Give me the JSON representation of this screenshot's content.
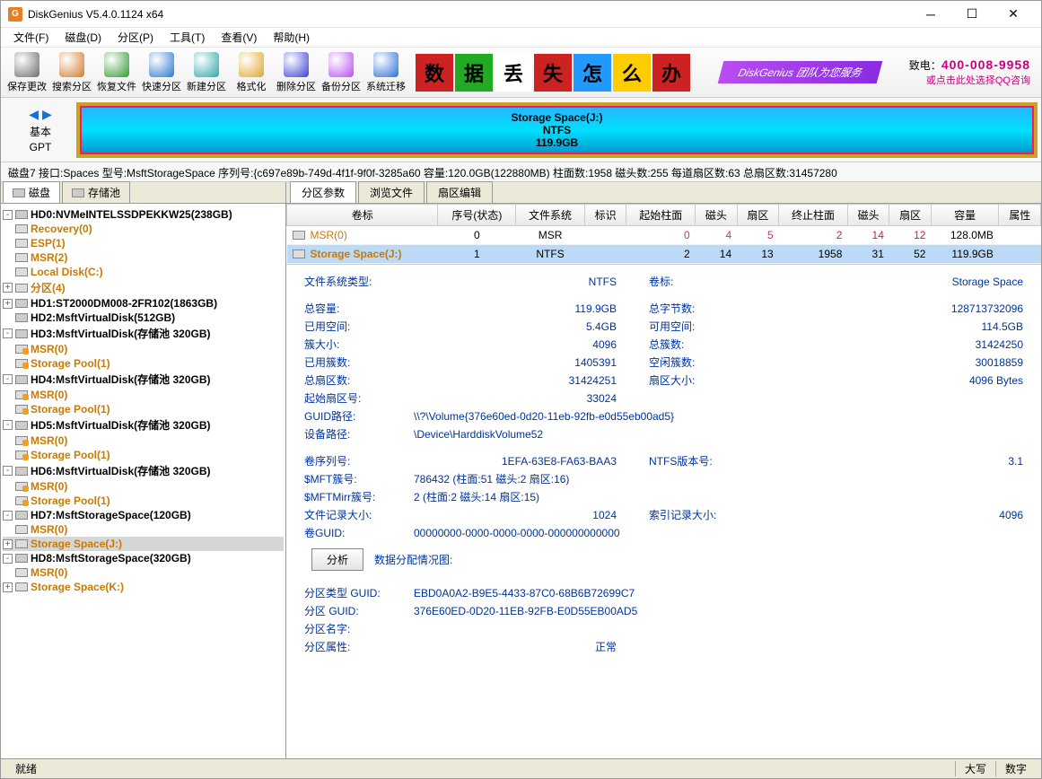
{
  "window": {
    "title": "DiskGenius V5.4.0.1124 x64",
    "icon_letter": "G"
  },
  "menu": [
    "文件(F)",
    "磁盘(D)",
    "分区(P)",
    "工具(T)",
    "查看(V)",
    "帮助(H)"
  ],
  "toolbar": [
    {
      "label": "保存更改",
      "color": "#6b6b6b"
    },
    {
      "label": "搜索分区",
      "color": "#d37a2a"
    },
    {
      "label": "恢复文件",
      "color": "#2e9a2e"
    },
    {
      "label": "快速分区",
      "color": "#2a77d3"
    },
    {
      "label": "新建分区",
      "color": "#2aa7a7"
    },
    {
      "label": "格式化",
      "color": "#e0a62a"
    },
    {
      "label": "删除分区",
      "color": "#3a3fd6"
    },
    {
      "label": "备份分区",
      "color": "#b84df0"
    },
    {
      "label": "系统迁移",
      "color": "#2a6fd6"
    }
  ],
  "promo": {
    "chars": [
      [
        "数",
        "#c22"
      ],
      [
        "据",
        "#2a2"
      ],
      [
        "丢",
        "#fff"
      ],
      [
        "失",
        "#c22"
      ],
      [
        "怎",
        "#29f"
      ],
      [
        "么",
        "#fc0"
      ],
      [
        "办",
        "#c22"
      ]
    ],
    "bubble": "DiskGenius 团队为您服务",
    "line1_pre": "致电：",
    "phone": "400-008-9958",
    "line2": "或点击此处选择QQ咨询"
  },
  "diskbar": {
    "left_l1": "基本",
    "left_l2": "GPT",
    "strip_l1": "Storage Space(J:)",
    "strip_l2": "NTFS",
    "strip_l3": "119.9GB"
  },
  "infoline": "磁盘7 接口:Spaces  型号:MsftStorageSpace  序列号:{c697e89b-749d-4f1f-9f0f-3285a60  容量:120.0GB(122880MB)  柱面数:1958  磁头数:255  每道扇区数:63  总扇区数:31457280",
  "lefttabs": {
    "t1": " 磁盘",
    "t2": " 存储池"
  },
  "tree": [
    {
      "d": 0,
      "exp": "-",
      "ico": "disk",
      "lbl": "HD0:NVMeINTELSSDPEKKW25(238GB)",
      "bold": true
    },
    {
      "d": 1,
      "exp": "",
      "ico": "vol",
      "lbl": "Recovery(0)",
      "cls": "orange"
    },
    {
      "d": 1,
      "exp": "",
      "ico": "vol",
      "lbl": "ESP(1)",
      "cls": "orange"
    },
    {
      "d": 1,
      "exp": "",
      "ico": "vol",
      "lbl": "MSR(2)",
      "cls": "orange"
    },
    {
      "d": 1,
      "exp": "",
      "ico": "vol",
      "lbl": "Local Disk(C:)",
      "cls": "orange"
    },
    {
      "d": 1,
      "exp": "+",
      "ico": "vol",
      "lbl": "分区(4)",
      "cls": "orange"
    },
    {
      "d": 0,
      "exp": "+",
      "ico": "disk",
      "lbl": "HD1:ST2000DM008-2FR102(1863GB)",
      "bold": true
    },
    {
      "d": 0,
      "exp": "",
      "ico": "disk",
      "lbl": "HD2:MsftVirtualDisk(512GB)",
      "bold": true
    },
    {
      "d": 0,
      "exp": "-",
      "ico": "disk",
      "lbl": "HD3:MsftVirtualDisk(存储池 320GB)",
      "bold": true
    },
    {
      "d": 1,
      "exp": "",
      "ico": "vollock",
      "lbl": "MSR(0)",
      "cls": "orange"
    },
    {
      "d": 1,
      "exp": "",
      "ico": "vollock",
      "lbl": "Storage Pool(1)",
      "cls": "orange"
    },
    {
      "d": 0,
      "exp": "-",
      "ico": "disk",
      "lbl": "HD4:MsftVirtualDisk(存储池 320GB)",
      "bold": true
    },
    {
      "d": 1,
      "exp": "",
      "ico": "vollock",
      "lbl": "MSR(0)",
      "cls": "orange"
    },
    {
      "d": 1,
      "exp": "",
      "ico": "vollock",
      "lbl": "Storage Pool(1)",
      "cls": "orange"
    },
    {
      "d": 0,
      "exp": "-",
      "ico": "disk",
      "lbl": "HD5:MsftVirtualDisk(存储池 320GB)",
      "bold": true
    },
    {
      "d": 1,
      "exp": "",
      "ico": "vollock",
      "lbl": "MSR(0)",
      "cls": "orange"
    },
    {
      "d": 1,
      "exp": "",
      "ico": "vollock",
      "lbl": "Storage Pool(1)",
      "cls": "orange"
    },
    {
      "d": 0,
      "exp": "-",
      "ico": "disk",
      "lbl": "HD6:MsftVirtualDisk(存储池 320GB)",
      "bold": true
    },
    {
      "d": 1,
      "exp": "",
      "ico": "vollock",
      "lbl": "MSR(0)",
      "cls": "orange"
    },
    {
      "d": 1,
      "exp": "",
      "ico": "vollock",
      "lbl": "Storage Pool(1)",
      "cls": "orange"
    },
    {
      "d": 0,
      "exp": "-",
      "ico": "disk",
      "lbl": "HD7:MsftStorageSpace(120GB)",
      "bold": true
    },
    {
      "d": 1,
      "exp": "",
      "ico": "vol",
      "lbl": "MSR(0)",
      "cls": "orange"
    },
    {
      "d": 1,
      "exp": "+",
      "ico": "vol",
      "lbl": "Storage Space(J:)",
      "cls": "orange",
      "hl": true
    },
    {
      "d": 0,
      "exp": "-",
      "ico": "disk",
      "lbl": "HD8:MsftStorageSpace(320GB)",
      "bold": true
    },
    {
      "d": 1,
      "exp": "",
      "ico": "vol",
      "lbl": "MSR(0)",
      "cls": "orange"
    },
    {
      "d": 1,
      "exp": "+",
      "ico": "vol",
      "lbl": "Storage Space(K:)",
      "cls": "orange"
    }
  ],
  "righttabs": [
    "分区参数",
    "浏览文件",
    "扇区编辑"
  ],
  "grid": {
    "cols": [
      "卷标",
      "序号(状态)",
      "文件系统",
      "标识",
      "起始柱面",
      "磁头",
      "扇区",
      "终止柱面",
      "磁头",
      "扇区",
      "容量",
      "属性"
    ],
    "rows": [
      {
        "name": "MSR(0)",
        "seq": "0",
        "fs": "MSR",
        "flag": "",
        "sc": "0",
        "sh": "4",
        "ss": "5",
        "ec": "2",
        "eh": "14",
        "es": "12",
        "cap": "128.0MB",
        "attr": "",
        "sel": false,
        "cls": "pink red"
      },
      {
        "name": "Storage Space(J:)",
        "seq": "1",
        "fs": "NTFS",
        "flag": "",
        "sc": "2",
        "sh": "14",
        "ss": "13",
        "ec": "1958",
        "eh": "31",
        "es": "52",
        "cap": "119.9GB",
        "attr": "",
        "sel": true,
        "bold": true
      }
    ]
  },
  "details1": [
    [
      "文件系统类型:",
      "NTFS",
      "卷标:",
      "Storage Space"
    ]
  ],
  "details2": [
    [
      "总容量:",
      "119.9GB",
      "总字节数:",
      "128713732096"
    ],
    [
      "已用空间:",
      "5.4GB",
      "可用空间:",
      "114.5GB"
    ],
    [
      "簇大小:",
      "4096",
      "总簇数:",
      "31424250"
    ],
    [
      "已用簇数:",
      "1405391",
      "空闲簇数:",
      "30018859"
    ],
    [
      "总扇区数:",
      "31424251",
      "扇区大小:",
      "4096 Bytes"
    ],
    [
      "起始扇区号:",
      "33024",
      "",
      ""
    ],
    [
      "GUID路径:",
      "\\\\?\\Volume{376e60ed-0d20-11eb-92fb-e0d55eb00ad5}",
      "",
      ""
    ],
    [
      "设备路径:",
      "\\Device\\HarddiskVolume52",
      "",
      ""
    ]
  ],
  "details3": [
    [
      "卷序列号:",
      "1EFA-63E8-FA63-BAA3",
      "NTFS版本号:",
      "3.1"
    ],
    [
      "$MFT簇号:",
      "786432 (柱面:51 磁头:2 扇区:16)",
      "",
      ""
    ],
    [
      "$MFTMirr簇号:",
      "2 (柱面:2 磁头:14 扇区:15)",
      "",
      ""
    ],
    [
      "文件记录大小:",
      "1024",
      "索引记录大小:",
      "4096"
    ],
    [
      "卷GUID:",
      "00000000-0000-0000-0000-000000000000",
      "",
      ""
    ]
  ],
  "analyze": {
    "btn": "分析",
    "lbl": "数据分配情况图:"
  },
  "details4": [
    [
      "分区类型 GUID:",
      "EBD0A0A2-B9E5-4433-87C0-68B6B72699C7",
      "",
      ""
    ],
    [
      "分区 GUID:",
      "376E60ED-0D20-11EB-92FB-E0D55EB00AD5",
      "",
      ""
    ],
    [
      "分区名字:",
      "",
      "",
      ""
    ],
    [
      "分区属性:",
      "正常",
      "",
      ""
    ]
  ],
  "status": {
    "left": "就绪",
    "mid": "大写",
    "right": "数字"
  }
}
